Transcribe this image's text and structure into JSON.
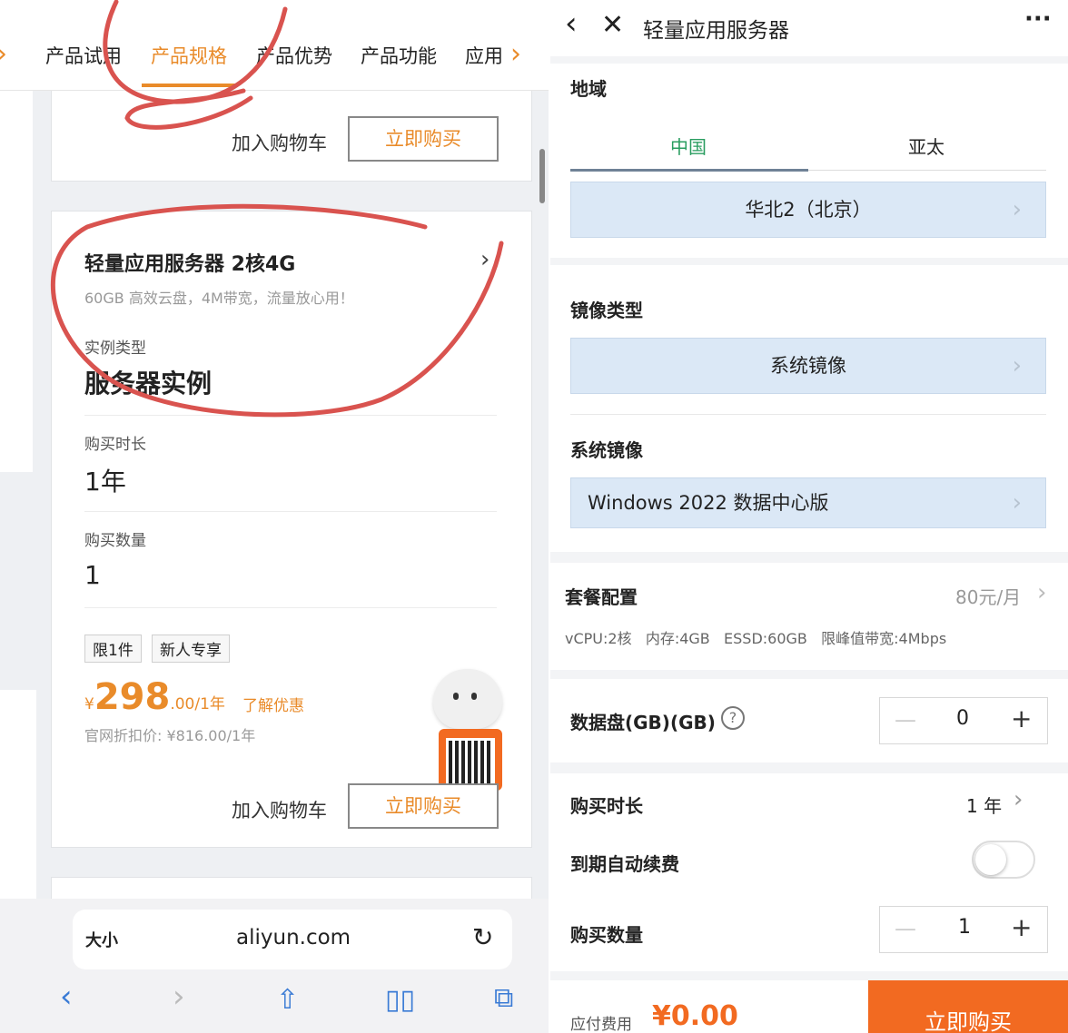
{
  "left": {
    "tabs": [
      "产品试用",
      "产品规格",
      "产品优势",
      "产品功能",
      "应用"
    ],
    "active_tab": "产品规格",
    "top_card": {
      "cart_label": "加入购物车",
      "buy_label": "立即购买"
    },
    "product_card": {
      "title": "轻量应用服务器 2核4G",
      "subtitle": "60GB 高效云盘，4M带宽，流量放心用！",
      "instance_type_label": "实例类型",
      "instance_type_value": "服务器实例",
      "duration_label": "购买时长",
      "duration_value": "1年",
      "quantity_label": "购买数量",
      "quantity_value": "1",
      "tags": [
        "限1件",
        "新人专享"
      ],
      "currency": "¥",
      "price_int": "298",
      "price_dec": ".00/1年",
      "discount_link": "了解优惠",
      "official_price": "官网折扣价: ¥816.00/1年",
      "cart_label": "加入购物车",
      "buy_label": "立即购买"
    },
    "browser": {
      "text_size": "大小",
      "url": "aliyun.com"
    },
    "colors": {
      "accent": "#e98b2a",
      "annotation": "#d9534f"
    }
  },
  "right": {
    "title": "轻量应用服务器",
    "region_label": "地域",
    "region_tabs": [
      "中国",
      "亚太"
    ],
    "region_value": "华北2（北京）",
    "image_type_label": "镜像类型",
    "image_type_value": "系统镜像",
    "system_image_label": "系统镜像",
    "system_image_value": "Windows 2022 数据中心版",
    "plan_label": "套餐配置",
    "plan_price": "80元/月",
    "plan_spec": "vCPU:2核   内存:4GB   ESSD:60GB   限峰值带宽:4Mbps",
    "data_disk_label": "数据盘(GB)(GB)",
    "data_disk_value": "0",
    "duration_label": "购买时长",
    "duration_value": "1 年",
    "auto_renew_label": "到期自动续费",
    "quantity_label": "购买数量",
    "quantity_value": "1",
    "fee_label": "应付费用",
    "fee_value": "¥0.00",
    "buy_label": "立即购买",
    "colors": {
      "accent": "#f26a21",
      "select_bg": "#dbe8f6",
      "region_active": "#2a9d60"
    }
  }
}
